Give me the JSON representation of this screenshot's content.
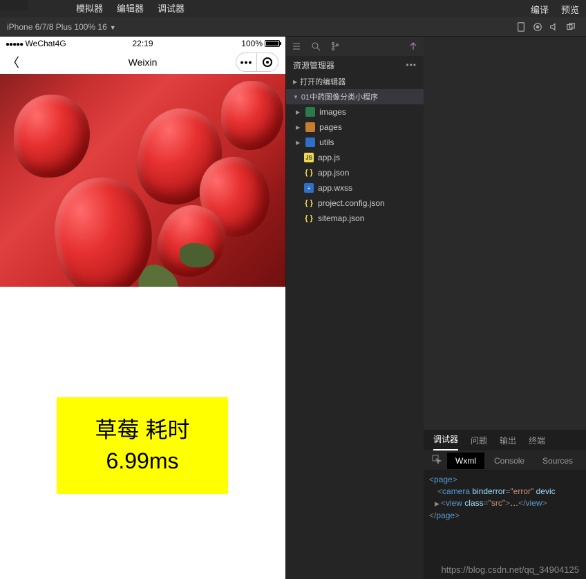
{
  "topbar": {
    "items": [
      "模拟器",
      "编辑器",
      "调试器"
    ],
    "right": [
      "编译",
      "预览"
    ]
  },
  "devicebar": {
    "label": "iPhone 6/7/8 Plus 100% 16"
  },
  "simulator": {
    "status": {
      "carrier": "WeChat4G",
      "time": "22:19",
      "battery": "100%"
    },
    "nav": {
      "title": "Weixin"
    },
    "result": {
      "line1": "草莓 耗时",
      "line2": "6.99ms"
    }
  },
  "explorer": {
    "title": "资源管理器",
    "sections": {
      "open_editors": "打开的编辑器",
      "project": "01中药图像分类小程序"
    },
    "tree": [
      {
        "type": "folder",
        "icon": "folder-green",
        "label": "images",
        "expandable": true
      },
      {
        "type": "folder",
        "icon": "folder-orange",
        "label": "pages",
        "expandable": true
      },
      {
        "type": "folder",
        "icon": "folder-blue",
        "label": "utils",
        "expandable": true
      },
      {
        "type": "file",
        "icon": "js",
        "iconText": "JS",
        "label": "app.js"
      },
      {
        "type": "file",
        "icon": "json",
        "iconText": "{ }",
        "label": "app.json"
      },
      {
        "type": "file",
        "icon": "wxss",
        "iconText": "≡",
        "label": "app.wxss"
      },
      {
        "type": "file",
        "icon": "json",
        "iconText": "{ }",
        "label": "project.config.json"
      },
      {
        "type": "file",
        "icon": "json",
        "iconText": "{ }",
        "label": "sitemap.json"
      }
    ]
  },
  "devtools": {
    "tabs1": [
      "调试器",
      "问题",
      "输出",
      "终端"
    ],
    "tabs2": [
      "Wxml",
      "Console",
      "Sources"
    ],
    "code": {
      "l1a": "<",
      "l1b": "page",
      "l1c": ">",
      "l2a": "<",
      "l2b": "camera",
      "l2c": " binderror",
      "l2d": "=",
      "l2e": "\"error\"",
      "l2f": " devic",
      "l3a": "<",
      "l3b": "view",
      "l3c": " class",
      "l3d": "=",
      "l3e": "\"src\"",
      "l3f": ">",
      "l3g": "…",
      "l3h": "</",
      "l3i": "view",
      "l3j": ">",
      "l4a": "</",
      "l4b": "page",
      "l4c": ">"
    }
  },
  "watermark": "https://blog.csdn.net/qq_34904125"
}
